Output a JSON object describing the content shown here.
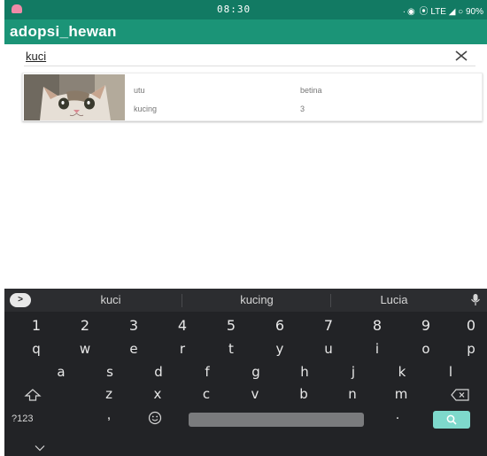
{
  "status_bar": {
    "time": "08:30",
    "system_icons": "· ◉  ⦿ LTE ◢ ○ 90%"
  },
  "toolbar": {
    "title": "adopsi_hewan"
  },
  "search": {
    "value": "kuci"
  },
  "results": [
    {
      "name": "utu",
      "type": "kucing",
      "gender": "betina",
      "age": "3"
    }
  ],
  "keyboard": {
    "suggestions": [
      "kuci",
      "kucing",
      "Lucia"
    ],
    "expand_symbol": ">",
    "row_numbers": [
      "1",
      "2",
      "3",
      "4",
      "5",
      "6",
      "7",
      "8",
      "9",
      "0"
    ],
    "row_top": [
      "q",
      "w",
      "e",
      "r",
      "t",
      "y",
      "u",
      "i",
      "o",
      "p"
    ],
    "row_middle": [
      "a",
      "s",
      "d",
      "f",
      "g",
      "h",
      "j",
      "k",
      "l"
    ],
    "row_bottom": [
      "z",
      "x",
      "c",
      "v",
      "b",
      "n",
      "m"
    ],
    "symbols_label": "?123",
    "comma": ",",
    "period": "."
  },
  "colors": {
    "status_bar": "#127a63",
    "toolbar": "#1b9477",
    "keyboard_bg": "#222326",
    "search_key": "#7ed9cc"
  }
}
